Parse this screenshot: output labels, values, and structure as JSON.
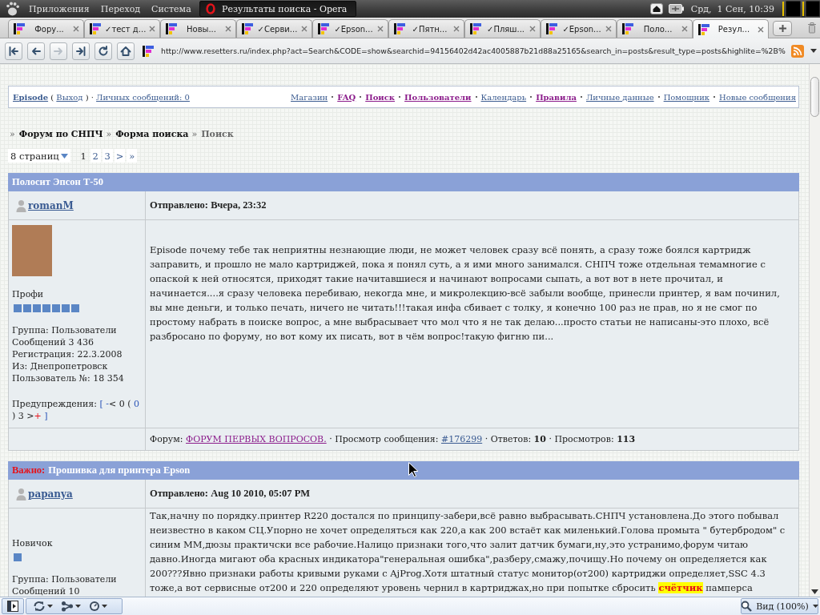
{
  "desktop_panel": {
    "menus": [
      "Приложения",
      "Переход",
      "Система"
    ],
    "window_button": "Результаты поиска - Opera",
    "clock": "Срд,  1 Сен, 10:39"
  },
  "tabs": [
    {
      "title": "Фору...",
      "selected": false
    },
    {
      "title": "✓тест д...",
      "selected": false
    },
    {
      "title": "Новы...",
      "selected": false
    },
    {
      "title": "✓Серви...",
      "selected": false
    },
    {
      "title": "✓Epson...",
      "selected": false
    },
    {
      "title": "✓Пятн...",
      "selected": false
    },
    {
      "title": "✓Пляш...",
      "selected": false
    },
    {
      "title": "✓Epson...",
      "selected": false
    },
    {
      "title": "Поло...",
      "selected": false
    },
    {
      "title": "Резул...",
      "selected": true
    }
  ],
  "toolbar": {
    "buttons": [
      {
        "kind": "rewind",
        "disabled": false
      },
      {
        "kind": "back",
        "disabled": false
      },
      {
        "kind": "forward",
        "disabled": true
      },
      {
        "kind": "fast_forward",
        "disabled": false
      },
      {
        "kind": "reload",
        "disabled": false
      },
      {
        "kind": "home",
        "disabled": false
      }
    ],
    "url": "http://www.resetters.ru/index.php?act=Search&CODE=show&searchid=94156402d42ac4005887b21d88a25165&search_in=posts&result_type=posts&highlite=%2B%"
  },
  "user_bar": [
    {
      "kind": "username",
      "text": "Episode"
    },
    {
      "kind": "text",
      "text": " ( "
    },
    {
      "kind": "logout",
      "text": "Выход"
    },
    {
      "kind": "text",
      "text": " ) · "
    },
    {
      "kind": "messages",
      "text": "Личных сообщений: 0"
    }
  ],
  "nav_links": [
    {
      "text": "Магазин",
      "visited": false
    },
    {
      "text": "FAQ",
      "visited": true
    },
    {
      "text": "Поиск",
      "visited": true
    },
    {
      "text": "Пользователи",
      "visited": true
    },
    {
      "text": "Календарь",
      "visited": false
    },
    {
      "text": "Правила",
      "visited": true
    },
    {
      "text": "Личные данные",
      "visited": false
    },
    {
      "text": "Помощник",
      "visited": false
    },
    {
      "text": "Новые сообщения",
      "visited": false
    }
  ],
  "breadcrumb": [
    {
      "separator": "»",
      "text": "Форум по СНПЧ",
      "current": false
    },
    {
      "separator": "»",
      "text": "Форма поиска",
      "current": false
    },
    {
      "separator": "»",
      "text": "Поиск",
      "current": true
    }
  ],
  "pagination": {
    "pages_menu": "8 страниц",
    "pages": [
      {
        "label": "1",
        "selected": true
      },
      {
        "label": "2",
        "selected": false
      },
      {
        "label": "3",
        "selected": false
      }
    ],
    "next": ">",
    "last": "»"
  },
  "posts": [
    {
      "title": "Полосит Эпсон Т-50",
      "author": "romanM",
      "posted": "Отправлено: Вчера, 23:32",
      "avatar": true,
      "rank": "Профи",
      "pips": [
        {
          "filled": true
        },
        {
          "filled": true
        },
        {
          "filled": true
        },
        {
          "filled": true
        },
        {
          "filled": true
        },
        {
          "filled": true
        },
        {
          "filled": true
        }
      ],
      "details": [
        "Группа: Пользователи",
        "Сообщений 3 436",
        "Регистрация: 22.3.2008",
        "Из: Днепропетровск",
        "Пользователь №: 18 354"
      ],
      "warnings": [
        {
          "kind": "text",
          "text": "Предупреждения: "
        },
        {
          "kind": "accent",
          "text": "[ -"
        },
        {
          "kind": "text",
          "text": "< 0 ( "
        },
        {
          "kind": "accent",
          "text": "0"
        },
        {
          "kind": "text",
          "text": " ) 3 >"
        },
        {
          "kind": "alert",
          "text": "+"
        },
        {
          "kind": "accent",
          "text": " ]"
        }
      ],
      "leading_gap": true,
      "body": [
        {
          "kind": "text",
          "text": "Episode почему тебе так неприятны незнающие люди, не может человек сразу всё понять, а сразу тоже боялся картридж заправить, и прошло не мало картриджей, пока я понял суть, а я ими много занимался. СНПЧ тоже отдельная темамногие с опаской к ней относятся, приходят такие начитавшиеся и начинают вопросами сыпать, а вот вот в нете прочитал, и начинается....я сразу человека перебиваю, некогда мне, и микролекцию-всё забыли вообще, принесли принтер, я вам починил, вы мне деньги, и только печать, ничего не читать!!!такая инфа сбивает с толку, я конечно 100 раз не прав, но я не смог по простому набрать в поиске вопрос, а мне выбрасывает что мол что я не так делаю...просто статьи не написаны-это плохо, всё разбросано по форуму, но вот кому их писать, вот в чём вопрос!такую фигню пи..."
        }
      ],
      "footer": [
        {
          "kind": "text",
          "text": "Форум: "
        },
        {
          "kind": "forum",
          "text": "ФОРУМ ПЕРВЫХ ВОПРОСОВ."
        },
        {
          "kind": "text",
          "text": " · Просмотр сообщения: "
        },
        {
          "kind": "post",
          "text": "#176299"
        },
        {
          "kind": "text",
          "text": " · Ответов: **10** · Просмотров: **113**"
        }
      ]
    },
    {
      "prefix": "Важно:",
      "title": "Прошивка для принтера Epson",
      "author": "papanya",
      "posted": "Отправлено: Aug 10 2010, 05:07 PM",
      "avatar": false,
      "rank": "Новичок",
      "pips": [
        {
          "filled": true
        }
      ],
      "details": [
        "Группа: Пользователи",
        "Сообщений 10"
      ],
      "leading_gap": false,
      "body": [
        {
          "kind": "text",
          "text": "Так,начну по порядку.принтер R220 достался по принципу-забери,всё равно выбрасывать.СНПЧ установлена.До этого побывал неизвестно в каком СЦ.Упорно не хочет определяться как 220,а как 200 встаёт как миленький.Голова промыта \" бутербродом\" с синим ММ,дюзы практичски все рабочие.Налицо признаки того,что залит датчик бумаги,ну,это устранимо,форум читаю давно.Иногда мигают оба красных индикатора\"генеральная ошибка\",разберу,смажу,почищу.Но почему он определяется как 200???Явно признаки работы кривыми руками с AjProg.Хотя штатный статус монитор(от200) картриджи определяет,SSC 4.3 тоже,а вот сервисные от200 и 220 определяют уровень чернил в картриджах,но при попытке сбросить "
        },
        {
          "kind": "highlight",
          "text": "счётчик"
        },
        {
          "kind": "text",
          "text": " памперса"
        }
      ]
    }
  ],
  "status_bar": {
    "zoom": "Вид (100%)"
  }
}
